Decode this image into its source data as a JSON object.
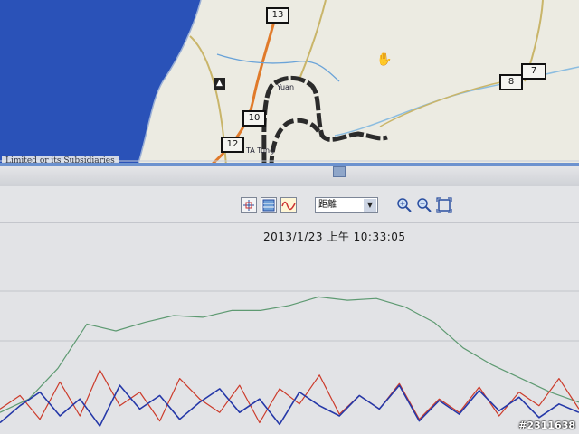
{
  "map": {
    "attribution": "Limited or its Subsidiaries",
    "route_shields": [
      "13",
      "10",
      "12",
      "8",
      "7"
    ],
    "place_labels": [
      "Yuan",
      "TA Tung"
    ]
  },
  "toolbar": {
    "axis_dropdown": {
      "selected": "距離"
    },
    "icons": [
      "crosshair-icon",
      "grid-icon",
      "waveform-icon",
      "zoom-in-icon",
      "zoom-out-icon",
      "fit-extent-icon"
    ]
  },
  "chart": {
    "timestamp": "2013/1/23 上午 10:33:05"
  },
  "watermark": "#2311638",
  "colors": {
    "sea": "#2a52b8",
    "land": "#ecebe2",
    "route": "#2b2b2b",
    "elevation_line": "#5e9a72",
    "series_red": "#cc3b2b",
    "series_blue": "#2538a8"
  },
  "chart_data": {
    "type": "line",
    "series": [
      {
        "values": [
          10,
          18,
          36,
          62,
          58,
          63,
          67,
          66,
          70,
          70,
          73,
          78,
          76,
          77,
          72,
          63,
          48,
          38,
          30,
          22,
          16
        ]
      },
      {
        "values": [
          12,
          20,
          6,
          28,
          8,
          35,
          14,
          22,
          5,
          30,
          18,
          10,
          26,
          4,
          24,
          15,
          32,
          9,
          20,
          12,
          27,
          6,
          18,
          10,
          25,
          8,
          22,
          14,
          30,
          12
        ]
      },
      {
        "values": [
          4,
          14,
          22,
          8,
          18,
          2,
          26,
          12,
          20,
          6,
          16,
          24,
          10,
          18,
          3,
          22,
          14,
          8,
          20,
          12,
          26,
          5,
          17,
          9,
          23,
          11,
          19,
          7,
          15,
          10
        ]
      }
    ]
  }
}
